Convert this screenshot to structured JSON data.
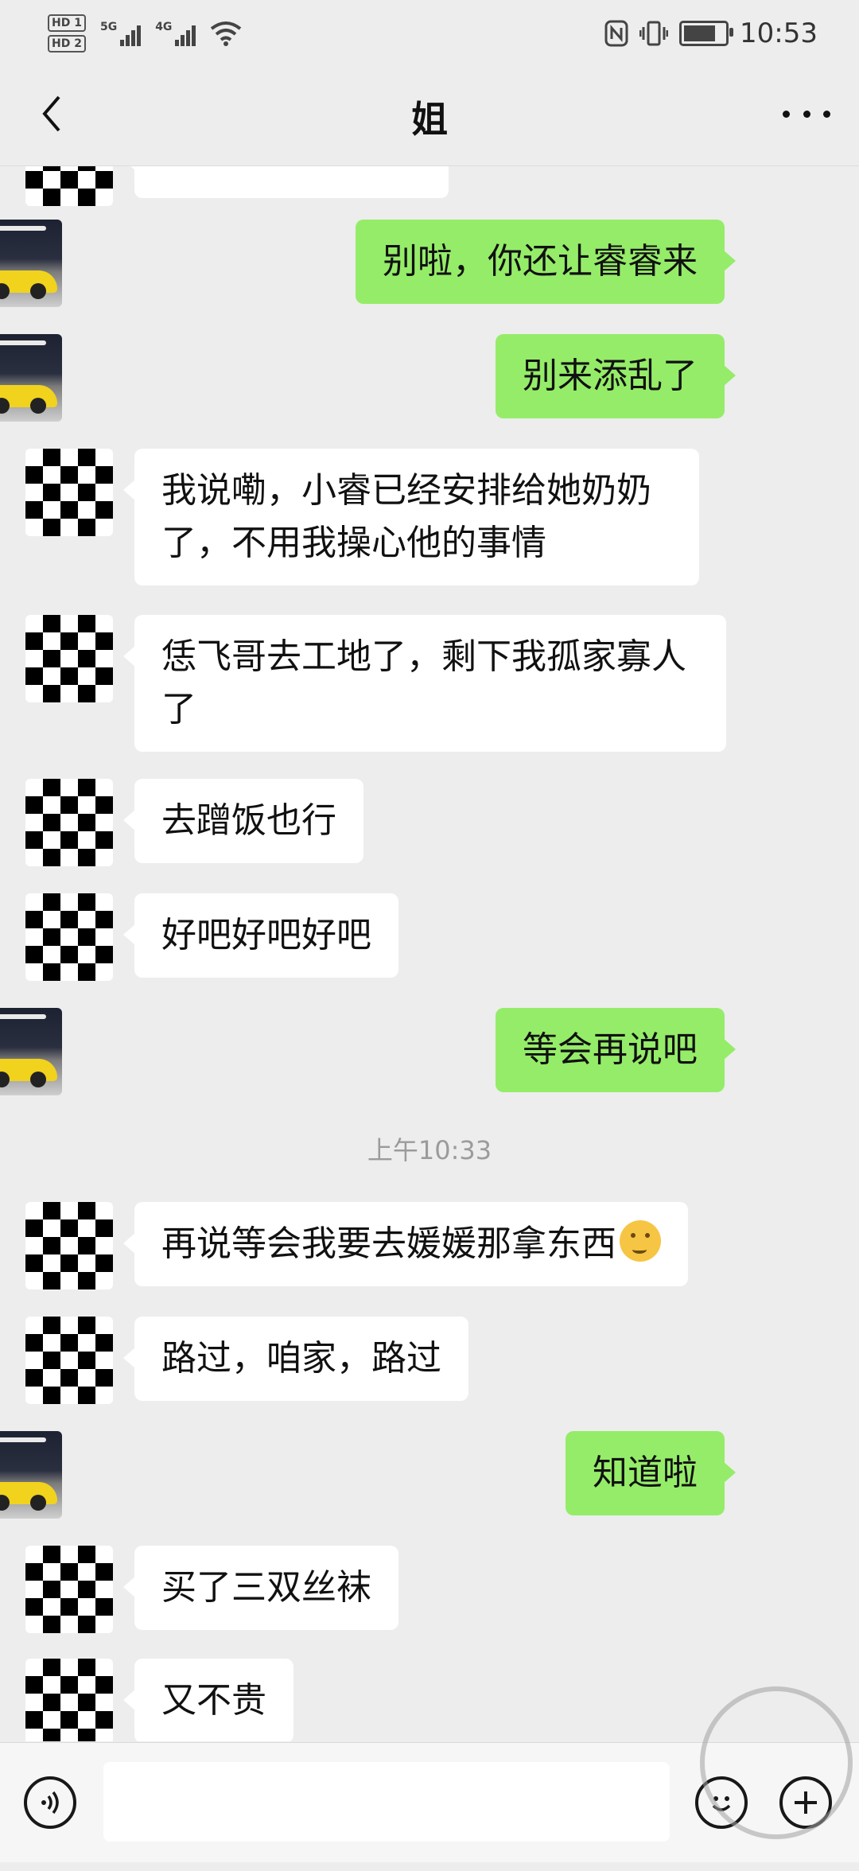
{
  "status_bar": {
    "time": "10:53",
    "sim1": "HD 1",
    "sim2": "HD 2",
    "net1": "5G",
    "net2": "4G"
  },
  "header": {
    "title": "姐",
    "back_icon": "chevron-left-icon",
    "more_icon": "more-dots-icon"
  },
  "messages": [
    {
      "dir": "out",
      "text": "别啦，你还让睿睿来"
    },
    {
      "dir": "out",
      "text": "别来添乱了"
    },
    {
      "dir": "in",
      "text": "我说嘞，小睿已经安排给她奶奶了，不用我操心他的事情"
    },
    {
      "dir": "in",
      "text": "恁飞哥去工地了，剩下我孤家寡人了"
    },
    {
      "dir": "in",
      "text": "去蹭饭也行"
    },
    {
      "dir": "in",
      "text": "好吧好吧好吧"
    },
    {
      "dir": "out",
      "text": "等会再说吧"
    },
    {
      "dir": "in",
      "text": "再说等会我要去媛媛那拿东西",
      "emoji": "thinking-face"
    },
    {
      "dir": "in",
      "text": "路过，咱家，路过"
    },
    {
      "dir": "out",
      "text": "知道啦"
    },
    {
      "dir": "in",
      "text": "买了三双丝袜"
    },
    {
      "dir": "in",
      "text": "又不贵"
    }
  ],
  "timestamp": "上午10:33",
  "input_bar": {
    "placeholder": "",
    "voice_icon": "voice-icon",
    "emoji_icon": "emoji-icon",
    "plus_icon": "plus-icon"
  },
  "colors": {
    "background": "#ededed",
    "outgoing_bubble": "#95ec69",
    "incoming_bubble": "#ffffff"
  }
}
